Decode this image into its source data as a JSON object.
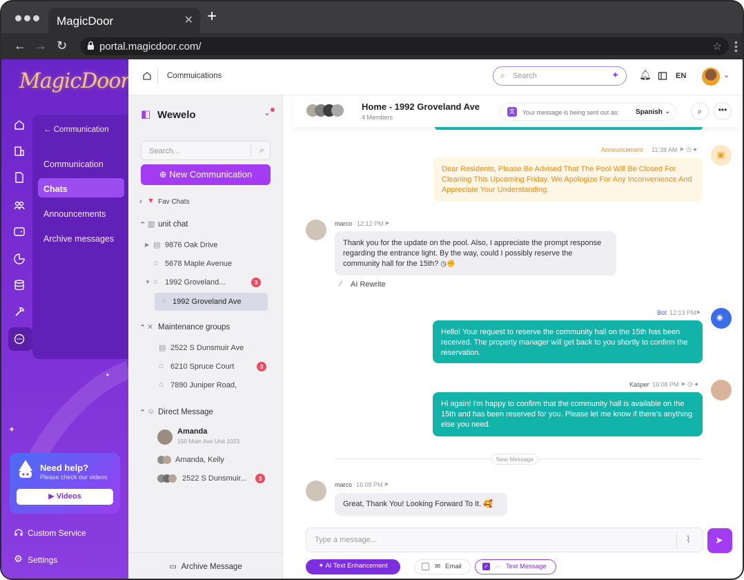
{
  "browser": {
    "tab_title": "MagicDoor",
    "url": "portal.magicdoor.com/"
  },
  "brand": {
    "logo_text": "MagicDoor"
  },
  "colors": {
    "accent": "#a23bf2",
    "teal": "#12b3a8",
    "announcement": "#f0a02a",
    "sidebar": "#6a25c8"
  },
  "submenu": {
    "back_label": "← Communication",
    "items": [
      "Communication",
      "Chats",
      "Announcements",
      "Archive messages"
    ],
    "active": "Chats"
  },
  "help": {
    "title": "Need help?",
    "subtitle": "Please check our videos",
    "button": "Videos"
  },
  "bottom_links": [
    "Custom Service",
    "Settings"
  ],
  "topbar": {
    "breadcrumb": "Commuications",
    "search_placeholder": "Search",
    "language": "EN"
  },
  "chat_list": {
    "workspace": "Wewelo",
    "search_placeholder": "Search...",
    "new_button": "New Communication",
    "fav_label": "Fav Chats",
    "unit_chat": {
      "label": "unit chat",
      "items": [
        {
          "name": "9876 Oak Drive"
        },
        {
          "name": "5678 Maple Avenue"
        },
        {
          "name": "1992 Groveland...",
          "badge": "3"
        }
      ],
      "selected": "1992 Groveland Ave"
    },
    "maintenance": {
      "label": "Maintenance groups",
      "items": [
        {
          "name": "2522 S Dunsmuir Ave"
        },
        {
          "name": "6210 Spruce Court",
          "badge": "3"
        },
        {
          "name": "7890 Juniper Road,"
        }
      ]
    },
    "direct": {
      "label": "Direct Message",
      "items": [
        {
          "name": "Amanda",
          "sub": "150 Main Ave Unit 1023"
        },
        {
          "name": "Amanda, Kelly"
        },
        {
          "name": "2522 S Dunsmuir...",
          "badge": "3"
        }
      ]
    },
    "archive_label": "Archive Message"
  },
  "chat": {
    "title": "Home - 1992 Groveland Ave",
    "members": "4 Members",
    "lang_note": "Your message is being sent out as:",
    "lang_value": "Spanish",
    "messages": [
      {
        "sender": "Announcement",
        "time": "11:38 AM",
        "text": "Dear Residents, Please Be Advised That The Pool Will Be Closed For Cleaning This Upcoming Friday. We Apologize For Any Inconvenience And Appreciate Your Understanding."
      },
      {
        "sender": "marco",
        "time": "12:12 PM",
        "text": "Thank you for the update on the pool. Also, I appreciate the prompt response regarding the entrance light. By the way, could I possibly reserve the community hall for the 15th?",
        "action": "AI Rewrite"
      },
      {
        "sender": "Bot",
        "time": "12:13 PM",
        "text": "Hello! Your request to reserve the community hall on the 15th has been received. The property manager will get back to you shortly to confirm the reservation."
      },
      {
        "sender": "Kasper",
        "time": "16:08 PM",
        "text": "Hi again! I'm happy to confirm that the community hall is available on the 15th and has been reserved for you. Please let me know if there's anything else you need."
      },
      {
        "sender": "marco",
        "time": "16:08 PM",
        "text": "Great, Thank You! Looking Forward To It. 🥰"
      }
    ],
    "divider": "New Message",
    "composer_placeholder": "Type a message...",
    "chips": {
      "ai": "AI Text Enhancement",
      "email": "Email",
      "text": "Text Message"
    }
  }
}
